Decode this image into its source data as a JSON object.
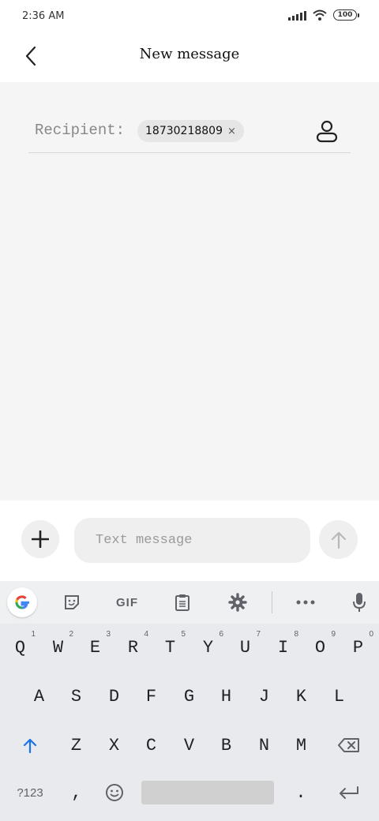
{
  "status_bar": {
    "time": "2:36 AM",
    "battery": "100",
    "signal_icon": "signal-icon",
    "wifi_icon": "wifi-icon"
  },
  "header": {
    "title": "New message",
    "back_icon": "chevron-left-icon"
  },
  "recipient": {
    "label": "Recipient:",
    "chip_text": "18730218809",
    "chip_close": "×",
    "contact_icon": "person-icon"
  },
  "compose": {
    "placeholder": "Text message",
    "add_icon": "plus-icon",
    "send_icon": "arrow-up-icon"
  },
  "keyboard": {
    "toolbar": {
      "gif_label": "GIF",
      "icons": [
        "google-icon",
        "sticker-icon",
        "gif-icon",
        "clipboard-icon",
        "gear-icon",
        "more-icon",
        "mic-icon"
      ]
    },
    "row1": [
      {
        "key": "Q",
        "hint": "1"
      },
      {
        "key": "W",
        "hint": "2"
      },
      {
        "key": "E",
        "hint": "3"
      },
      {
        "key": "R",
        "hint": "4"
      },
      {
        "key": "T",
        "hint": "5"
      },
      {
        "key": "Y",
        "hint": "6"
      },
      {
        "key": "U",
        "hint": "7"
      },
      {
        "key": "I",
        "hint": "8"
      },
      {
        "key": "O",
        "hint": "9"
      },
      {
        "key": "P",
        "hint": "0"
      }
    ],
    "row2": [
      "A",
      "S",
      "D",
      "F",
      "G",
      "H",
      "J",
      "K",
      "L"
    ],
    "row3": [
      "Z",
      "X",
      "C",
      "V",
      "B",
      "N",
      "M"
    ],
    "row4": {
      "symbols": "?123",
      "comma": ",",
      "period": "."
    },
    "accent_color": "#1a73e8"
  }
}
